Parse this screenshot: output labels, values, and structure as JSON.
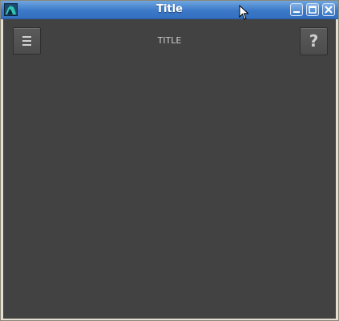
{
  "window": {
    "title": "Title",
    "icon": "app-icon",
    "controls": [
      "minimize-icon",
      "maximize-icon",
      "close-icon"
    ]
  },
  "app": {
    "title": "TITLE",
    "menu_icon": "hamburger-menu-icon",
    "help_label": "?"
  },
  "colors": {
    "titlebar": "#3b78c8",
    "content_background": "#424242",
    "button_background": "#525252",
    "text": "#c8c8c8"
  }
}
